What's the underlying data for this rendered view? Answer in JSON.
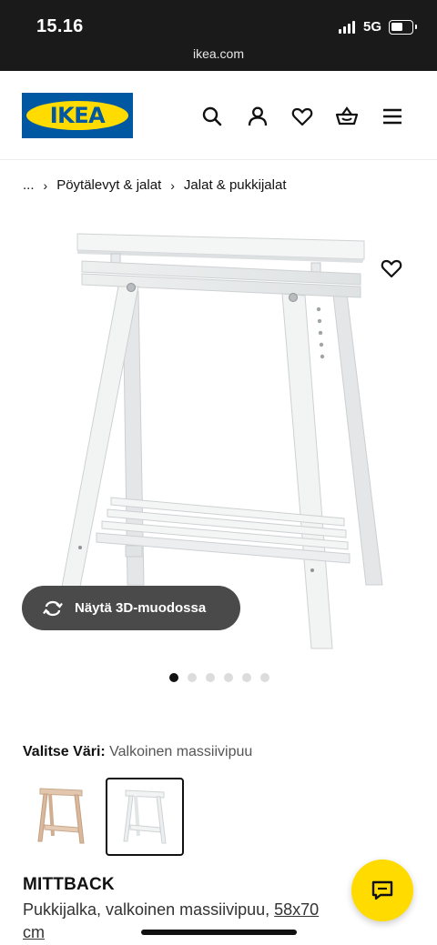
{
  "status_bar": {
    "time": "15.16",
    "network": "5G",
    "url": "ikea.com"
  },
  "header": {
    "logo": "IKEA",
    "icons": [
      "search-icon",
      "account-icon",
      "heart-icon",
      "basket-icon",
      "menu-icon"
    ],
    "brand_blue": "#0058a3",
    "brand_yellow": "#ffdb00"
  },
  "breadcrumb": {
    "items": [
      "...",
      "Pöytälevyt & jalat",
      "Jalat & pukkijalat"
    ]
  },
  "gallery": {
    "view_3d_label": "Näytä 3D-muodossa",
    "total_images": 6,
    "active_index": 0
  },
  "color_selector": {
    "label": "Valitse Väri:",
    "selected": "Valkoinen massiivipuu",
    "options": [
      {
        "name": "birch",
        "selected": false
      },
      {
        "name": "white",
        "selected": true
      }
    ]
  },
  "product": {
    "name": "MITTBACK",
    "description": "Pukkijalka, valkoinen massiivipuu, ",
    "size_link": "58x70",
    "size_unit": "cm"
  }
}
